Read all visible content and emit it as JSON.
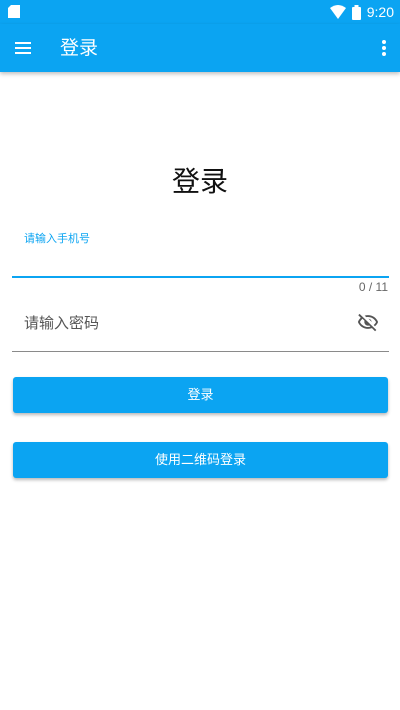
{
  "status_bar": {
    "time": "9:20",
    "left_icon": "sim-card-icon",
    "wifi_icon": "wifi-icon",
    "battery_icon": "battery-icon"
  },
  "app_bar": {
    "menu_icon": "menu-icon",
    "title": "登录",
    "more_icon": "more-vert-icon"
  },
  "main": {
    "heading": "登录",
    "phone": {
      "label": "请输入手机号",
      "value": "",
      "counter": "0 / 11"
    },
    "password": {
      "placeholder": "请输入密码",
      "value": "",
      "visibility_icon": "visibility-off-icon"
    },
    "login_button": "登录",
    "qr_login_button": "使用二维码登录"
  },
  "colors": {
    "primary": "#0ba4f2",
    "background": "#ffffff",
    "text": "#111111"
  }
}
